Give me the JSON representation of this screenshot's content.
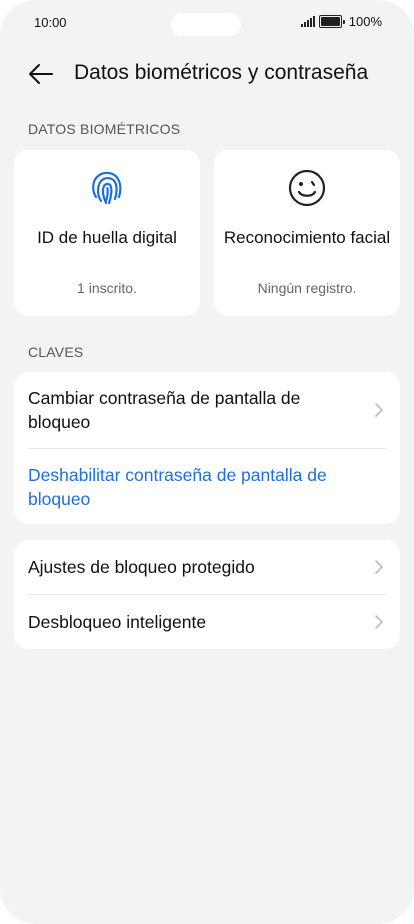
{
  "status": {
    "time": "10:00",
    "battery": "100%"
  },
  "header": {
    "title": "Datos biométricos y contraseña",
    "back_icon": "back-arrow-icon"
  },
  "biometrics": {
    "section_label": "DATOS BIOMÉTRICOS",
    "fingerprint": {
      "name": "ID de huella digital",
      "status": "1 inscrito.",
      "icon": "fingerprint-icon",
      "icon_color": "#1f6fd8"
    },
    "face": {
      "name": "Reconocimiento facial",
      "status": "Ningún registro.",
      "icon": "face-icon"
    }
  },
  "keys": {
    "section_label": "CLAVES",
    "change_password": "Cambiar contraseña de pantalla de bloqueo",
    "disable_password": "Deshabilitar contraseña de pantalla de bloqueo",
    "link_color": "#1f6fd8"
  },
  "other": {
    "protected_lock": "Ajustes de bloqueo protegido",
    "smart_unlock": "Desbloqueo inteligente"
  }
}
